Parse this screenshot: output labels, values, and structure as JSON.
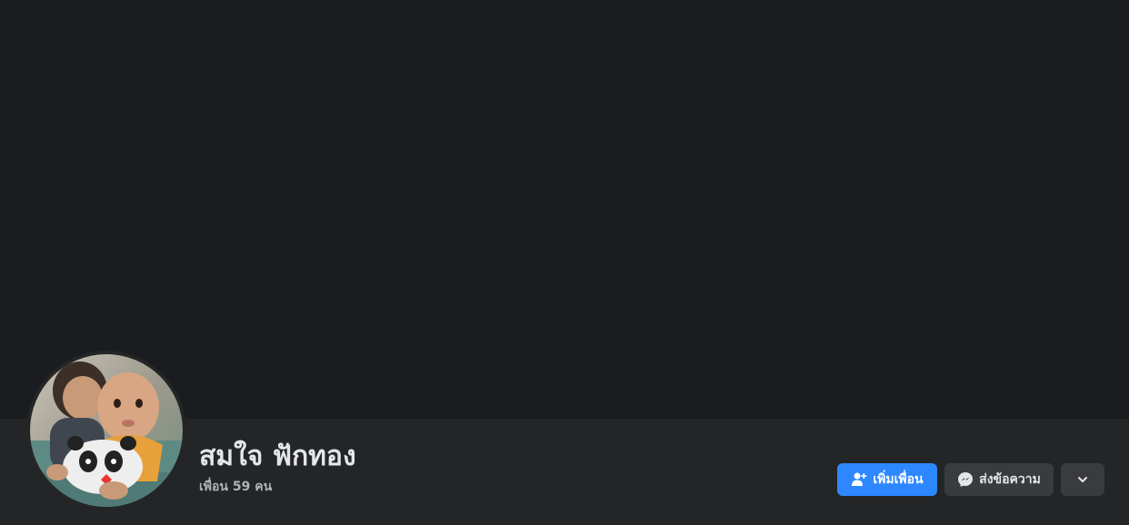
{
  "profile": {
    "name": "สมใจ ฟักทอง",
    "friends_text": "เพื่อน 59 คน"
  },
  "actions": {
    "add_friend_label": "เพิ่มเพื่อน",
    "message_label": "ส่งข้อความ",
    "more_icon": "chevron-down-icon",
    "add_friend_icon": "person-add-icon",
    "message_icon": "messenger-icon"
  },
  "colors": {
    "background": "#18191a",
    "cover": "#1b1c1f",
    "header_bar": "#242526",
    "primary_button": "#2d88ff",
    "secondary_button": "#3a3b3c",
    "primary_text": "#e4e6eb",
    "secondary_text": "#b0b3b8"
  }
}
